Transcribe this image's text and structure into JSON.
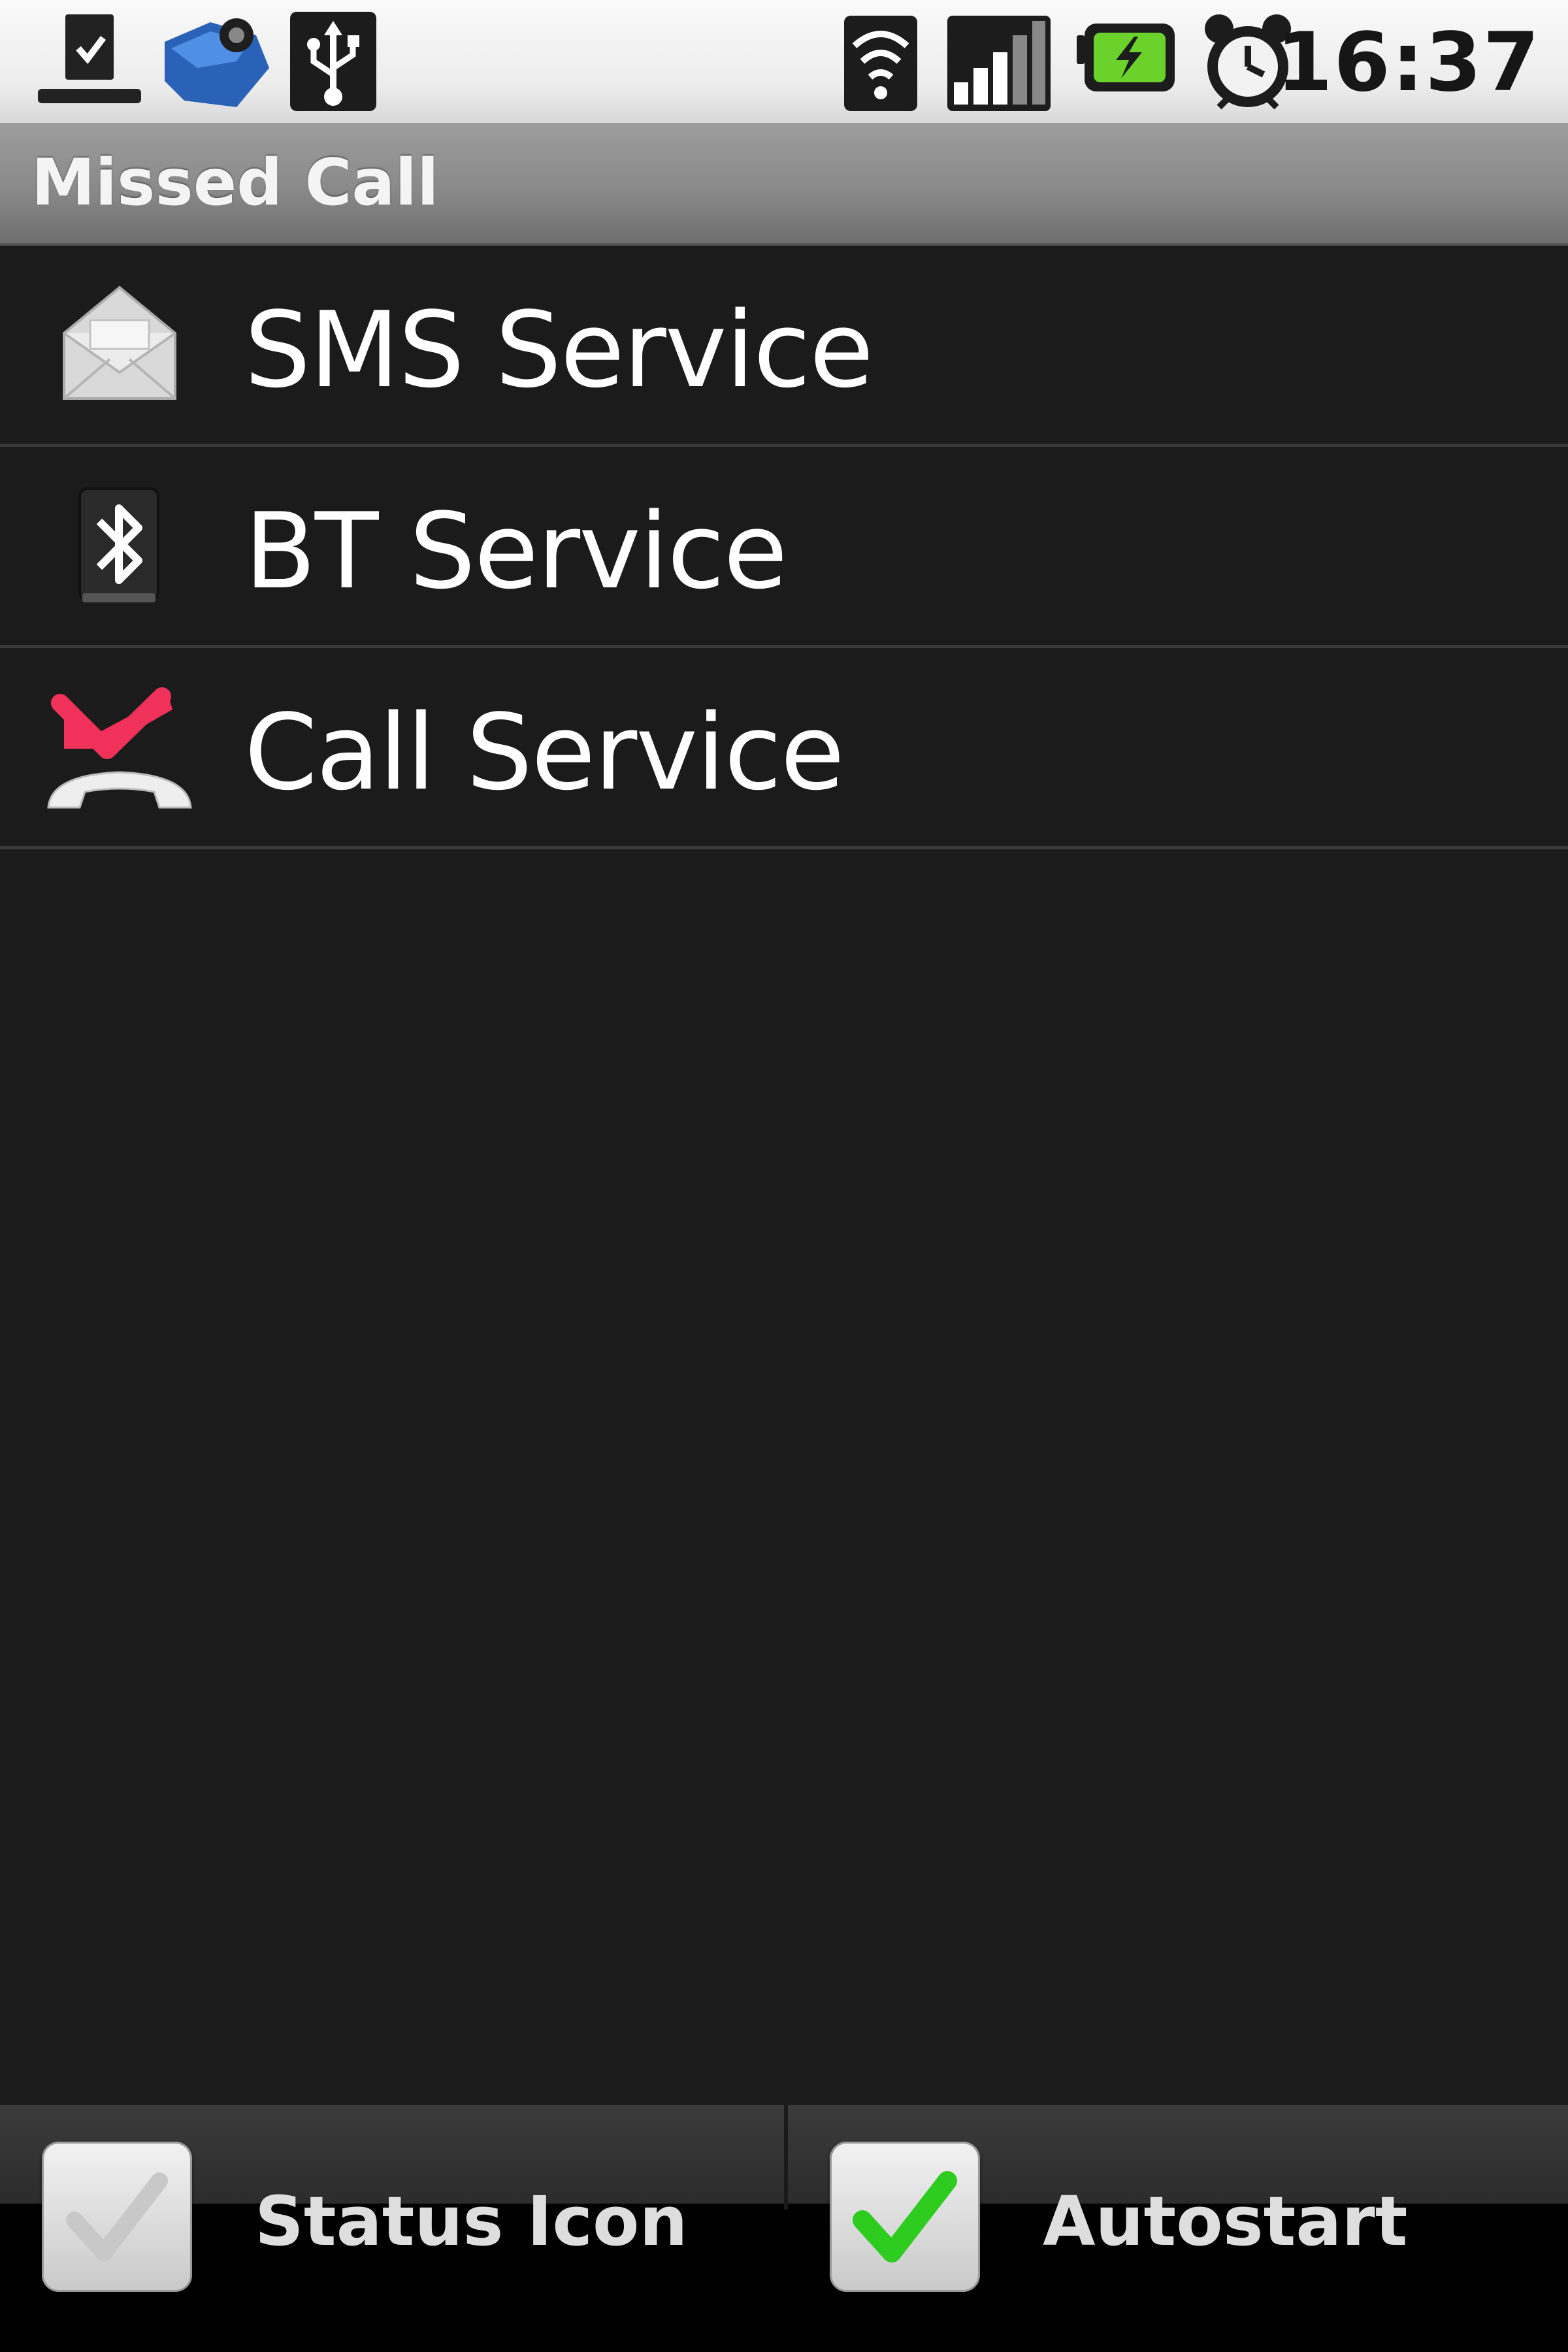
{
  "status_bar": {
    "time": "16:37",
    "left_icons": [
      "download-complete-icon",
      "sync-app-icon",
      "usb-icon"
    ],
    "right_icons": [
      "wifi-icon",
      "signal-icon",
      "battery-charging-icon",
      "alarm-icon"
    ]
  },
  "header": {
    "title": "Missed Call"
  },
  "services": [
    {
      "label": "SMS Service",
      "icon": "envelope-icon"
    },
    {
      "label": "BT Service",
      "icon": "bluetooth-icon"
    },
    {
      "label": "Call Service",
      "icon": "missed-call-icon"
    }
  ],
  "toggles": {
    "status_icon": {
      "label": "Status Icon",
      "checked": false
    },
    "autostart": {
      "label": "Autostart",
      "checked": true
    }
  },
  "colors": {
    "background": "#1b1b1b",
    "check_green": "#2ecc1f",
    "missed_call_red": "#f0325a"
  }
}
